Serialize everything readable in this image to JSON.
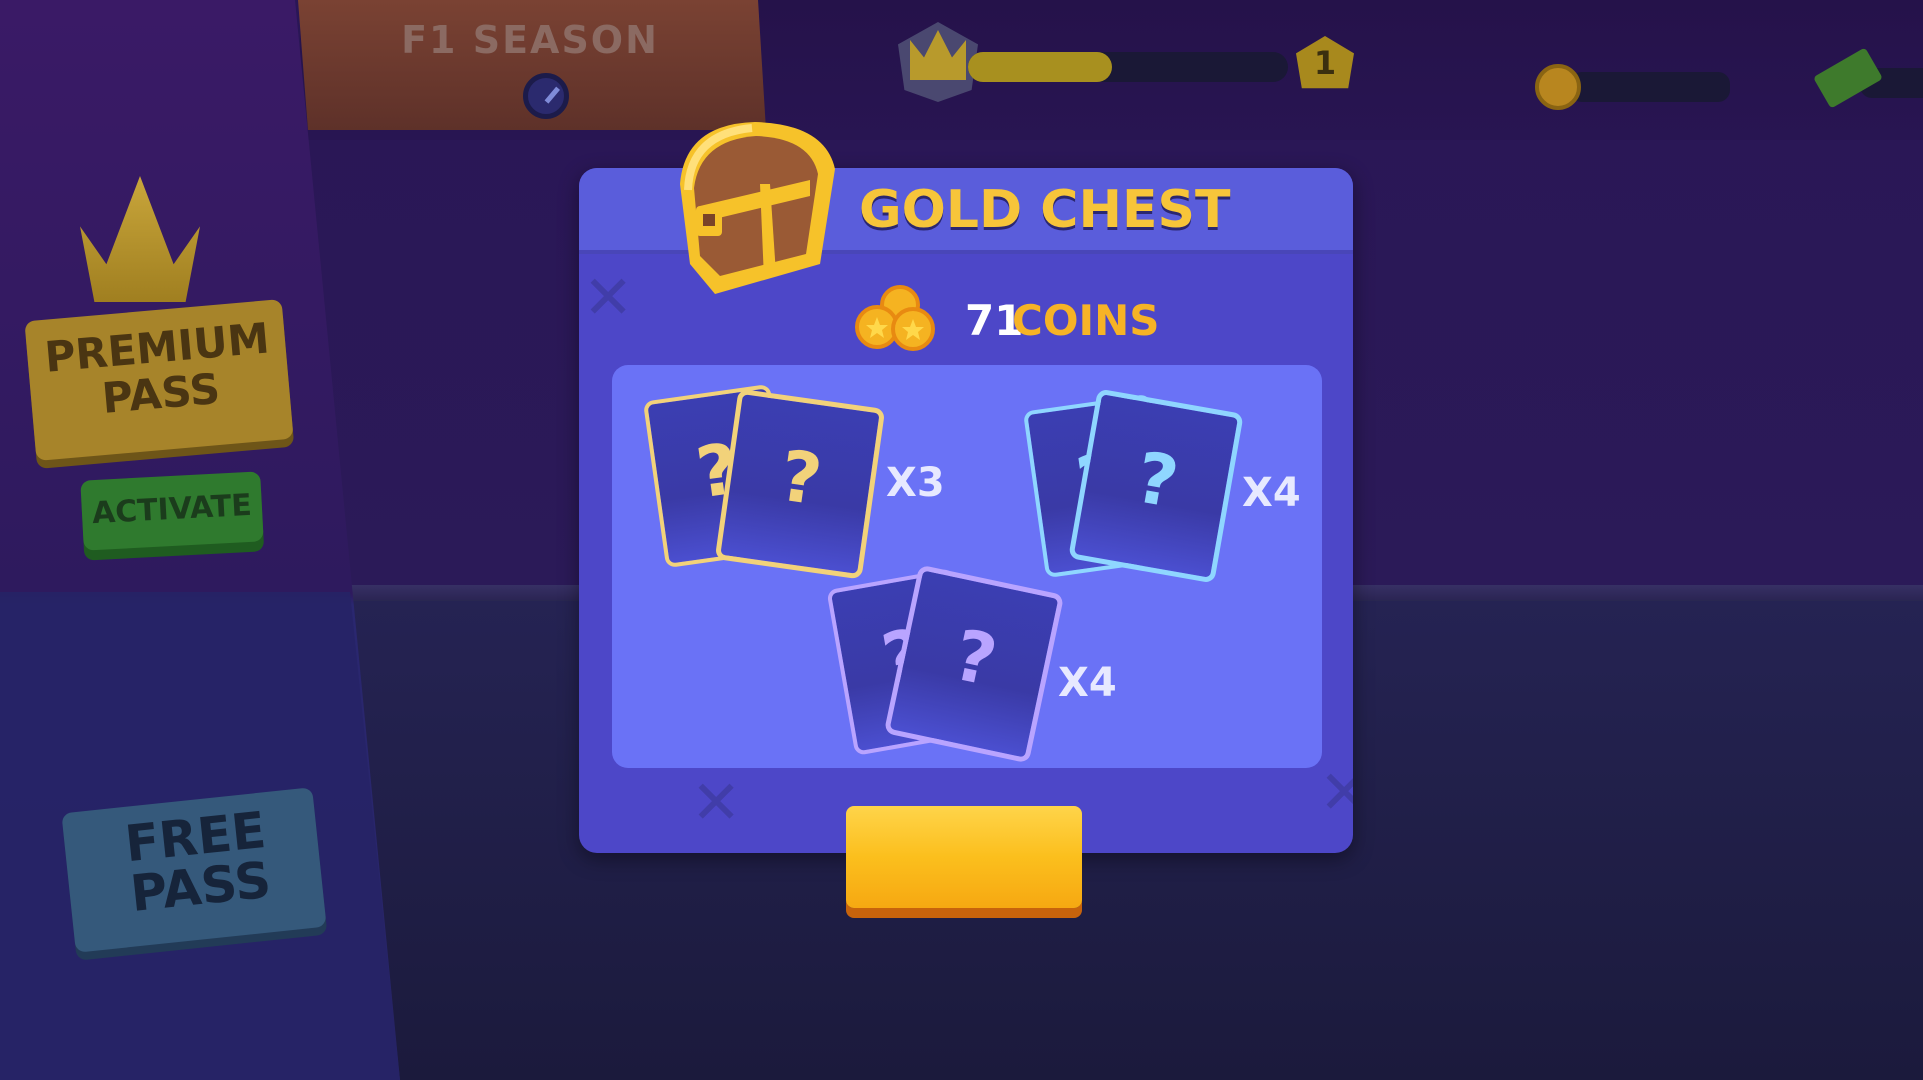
{
  "hud": {
    "season_title": "F1 SEASON",
    "level": "1",
    "xp_progress": 0.45,
    "coin_bar_value": "",
    "cash_bar_value": ""
  },
  "left_panel": {
    "premium_label": "PREMIUM\nPASS",
    "activate_label": "ACTIVATE",
    "free_label": "FREE\nPASS"
  },
  "dialog": {
    "title": "GOLD CHEST",
    "coins_amount": "71",
    "coins_label": "COINS",
    "rewards": [
      {
        "rarity": "gold",
        "card_symbol": "?",
        "multiplier": "X3"
      },
      {
        "rarity": "blue",
        "card_symbol": "?",
        "multiplier": "X4"
      },
      {
        "rarity": "purple",
        "card_symbol": "?",
        "multiplier": "X4"
      }
    ],
    "claim_button_label": ""
  },
  "colors": {
    "accent_gold": "#f7c53a",
    "coins_label": "#f6b326",
    "dialog_bg": "#4d47c8",
    "rewards_panel": "#6a72f6",
    "card_gold_border": "#f2d27a",
    "card_blue_border": "#8fd6ff",
    "card_purple_border": "#b9a4ff"
  },
  "icons": [
    "timer-icon",
    "crown-icon",
    "level-badge-icon",
    "coin-icon",
    "cash-icon",
    "chest-icon",
    "coin-stack-icon",
    "mystery-card-icon"
  ]
}
